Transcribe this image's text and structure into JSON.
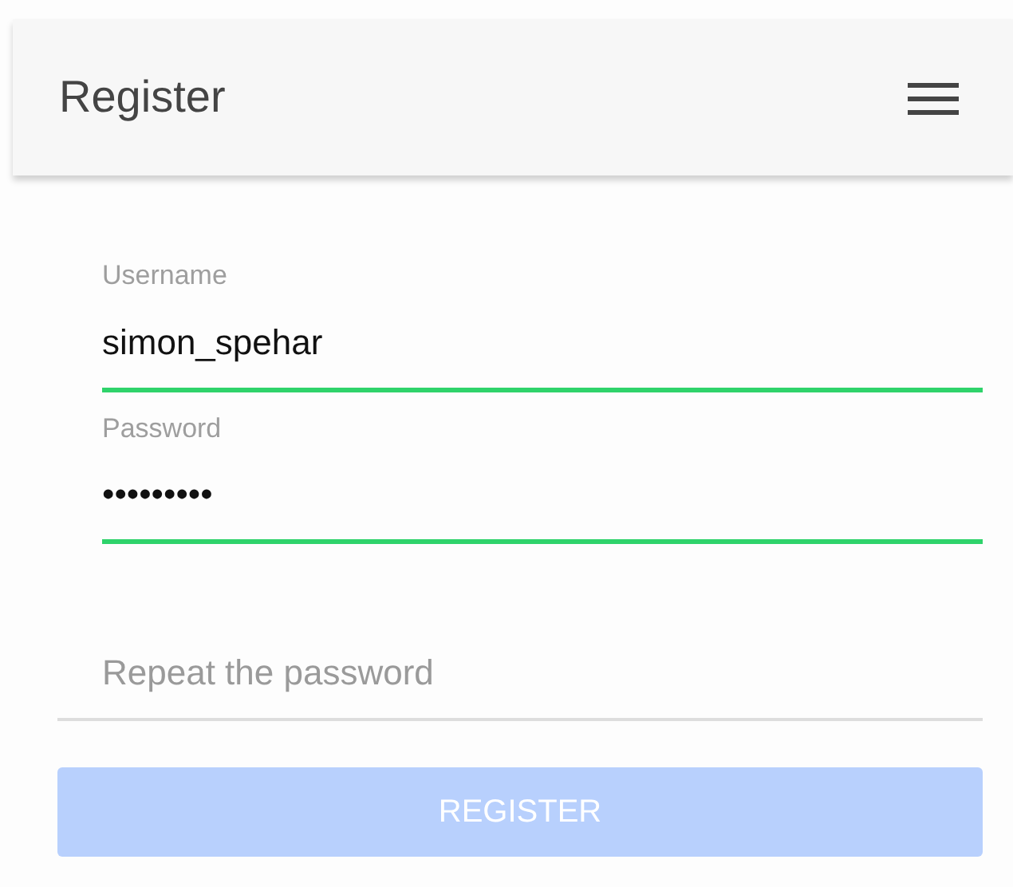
{
  "app_bar": {
    "title": "Register"
  },
  "fields": [
    {
      "kind": "labeled",
      "label": "Username",
      "value": "simon_spehar",
      "valid": true
    },
    {
      "kind": "labeled",
      "label": "Password",
      "value": "•••••••••",
      "valid": true
    },
    {
      "kind": "plain",
      "placeholder": "Repeat the password",
      "valid": false
    }
  ],
  "submit": {
    "label": "REGISTER",
    "disabled": true
  }
}
